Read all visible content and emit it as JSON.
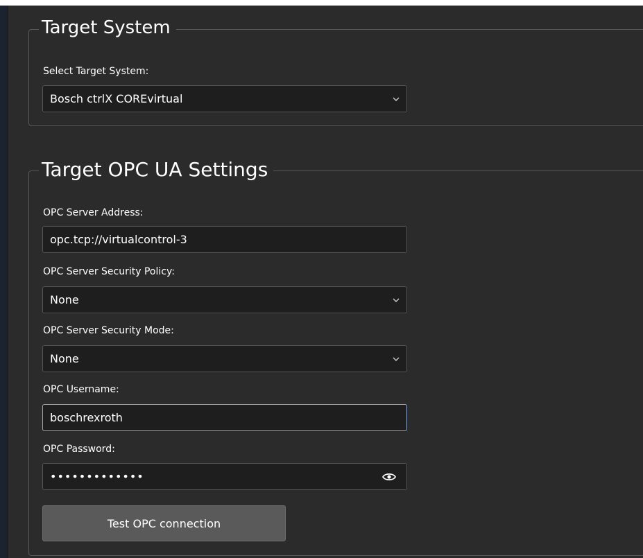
{
  "target_system": {
    "title": "Target System",
    "select_label": "Select Target System:",
    "select_value": "Bosch ctrlX COREvirtual"
  },
  "opc_settings": {
    "title": "Target OPC UA Settings",
    "server_address_label": "OPC Server Address:",
    "server_address_value": "opc.tcp://virtualcontrol-3",
    "security_policy_label": "OPC Server Security Policy:",
    "security_policy_value": "None",
    "security_mode_label": "OPC Server Security Mode:",
    "security_mode_value": "None",
    "username_label": "OPC Username:",
    "username_value": "boschrexroth",
    "password_label": "OPC Password:",
    "password_value": "•••••••••••••",
    "test_button_label": "Test OPC connection"
  },
  "icons": {
    "dropdown": "chevron-down-icon",
    "reveal_password": "eye-icon"
  }
}
